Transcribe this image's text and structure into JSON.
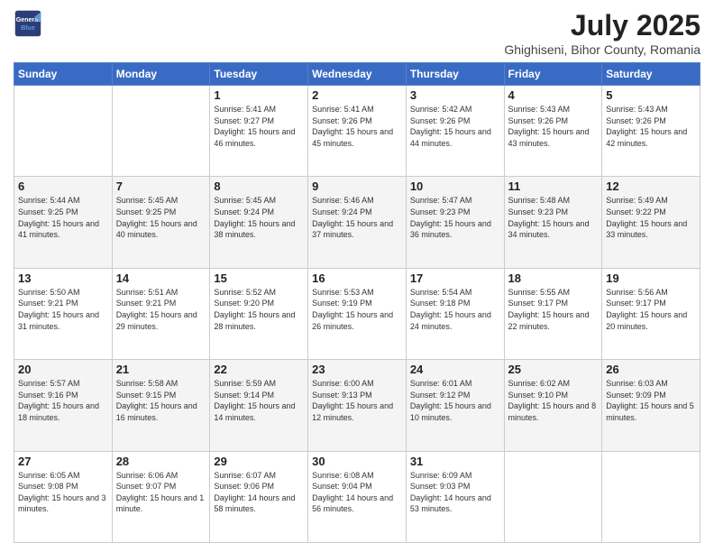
{
  "header": {
    "logo_line1": "General",
    "logo_line2": "Blue",
    "title": "July 2025",
    "subtitle": "Ghighiseni, Bihor County, Romania"
  },
  "weekdays": [
    "Sunday",
    "Monday",
    "Tuesday",
    "Wednesday",
    "Thursday",
    "Friday",
    "Saturday"
  ],
  "weeks": [
    [
      {
        "day": "",
        "info": ""
      },
      {
        "day": "",
        "info": ""
      },
      {
        "day": "1",
        "info": "Sunrise: 5:41 AM\nSunset: 9:27 PM\nDaylight: 15 hours and 46 minutes."
      },
      {
        "day": "2",
        "info": "Sunrise: 5:41 AM\nSunset: 9:26 PM\nDaylight: 15 hours and 45 minutes."
      },
      {
        "day": "3",
        "info": "Sunrise: 5:42 AM\nSunset: 9:26 PM\nDaylight: 15 hours and 44 minutes."
      },
      {
        "day": "4",
        "info": "Sunrise: 5:43 AM\nSunset: 9:26 PM\nDaylight: 15 hours and 43 minutes."
      },
      {
        "day": "5",
        "info": "Sunrise: 5:43 AM\nSunset: 9:26 PM\nDaylight: 15 hours and 42 minutes."
      }
    ],
    [
      {
        "day": "6",
        "info": "Sunrise: 5:44 AM\nSunset: 9:25 PM\nDaylight: 15 hours and 41 minutes."
      },
      {
        "day": "7",
        "info": "Sunrise: 5:45 AM\nSunset: 9:25 PM\nDaylight: 15 hours and 40 minutes."
      },
      {
        "day": "8",
        "info": "Sunrise: 5:45 AM\nSunset: 9:24 PM\nDaylight: 15 hours and 38 minutes."
      },
      {
        "day": "9",
        "info": "Sunrise: 5:46 AM\nSunset: 9:24 PM\nDaylight: 15 hours and 37 minutes."
      },
      {
        "day": "10",
        "info": "Sunrise: 5:47 AM\nSunset: 9:23 PM\nDaylight: 15 hours and 36 minutes."
      },
      {
        "day": "11",
        "info": "Sunrise: 5:48 AM\nSunset: 9:23 PM\nDaylight: 15 hours and 34 minutes."
      },
      {
        "day": "12",
        "info": "Sunrise: 5:49 AM\nSunset: 9:22 PM\nDaylight: 15 hours and 33 minutes."
      }
    ],
    [
      {
        "day": "13",
        "info": "Sunrise: 5:50 AM\nSunset: 9:21 PM\nDaylight: 15 hours and 31 minutes."
      },
      {
        "day": "14",
        "info": "Sunrise: 5:51 AM\nSunset: 9:21 PM\nDaylight: 15 hours and 29 minutes."
      },
      {
        "day": "15",
        "info": "Sunrise: 5:52 AM\nSunset: 9:20 PM\nDaylight: 15 hours and 28 minutes."
      },
      {
        "day": "16",
        "info": "Sunrise: 5:53 AM\nSunset: 9:19 PM\nDaylight: 15 hours and 26 minutes."
      },
      {
        "day": "17",
        "info": "Sunrise: 5:54 AM\nSunset: 9:18 PM\nDaylight: 15 hours and 24 minutes."
      },
      {
        "day": "18",
        "info": "Sunrise: 5:55 AM\nSunset: 9:17 PM\nDaylight: 15 hours and 22 minutes."
      },
      {
        "day": "19",
        "info": "Sunrise: 5:56 AM\nSunset: 9:17 PM\nDaylight: 15 hours and 20 minutes."
      }
    ],
    [
      {
        "day": "20",
        "info": "Sunrise: 5:57 AM\nSunset: 9:16 PM\nDaylight: 15 hours and 18 minutes."
      },
      {
        "day": "21",
        "info": "Sunrise: 5:58 AM\nSunset: 9:15 PM\nDaylight: 15 hours and 16 minutes."
      },
      {
        "day": "22",
        "info": "Sunrise: 5:59 AM\nSunset: 9:14 PM\nDaylight: 15 hours and 14 minutes."
      },
      {
        "day": "23",
        "info": "Sunrise: 6:00 AM\nSunset: 9:13 PM\nDaylight: 15 hours and 12 minutes."
      },
      {
        "day": "24",
        "info": "Sunrise: 6:01 AM\nSunset: 9:12 PM\nDaylight: 15 hours and 10 minutes."
      },
      {
        "day": "25",
        "info": "Sunrise: 6:02 AM\nSunset: 9:10 PM\nDaylight: 15 hours and 8 minutes."
      },
      {
        "day": "26",
        "info": "Sunrise: 6:03 AM\nSunset: 9:09 PM\nDaylight: 15 hours and 5 minutes."
      }
    ],
    [
      {
        "day": "27",
        "info": "Sunrise: 6:05 AM\nSunset: 9:08 PM\nDaylight: 15 hours and 3 minutes."
      },
      {
        "day": "28",
        "info": "Sunrise: 6:06 AM\nSunset: 9:07 PM\nDaylight: 15 hours and 1 minute."
      },
      {
        "day": "29",
        "info": "Sunrise: 6:07 AM\nSunset: 9:06 PM\nDaylight: 14 hours and 58 minutes."
      },
      {
        "day": "30",
        "info": "Sunrise: 6:08 AM\nSunset: 9:04 PM\nDaylight: 14 hours and 56 minutes."
      },
      {
        "day": "31",
        "info": "Sunrise: 6:09 AM\nSunset: 9:03 PM\nDaylight: 14 hours and 53 minutes."
      },
      {
        "day": "",
        "info": ""
      },
      {
        "day": "",
        "info": ""
      }
    ]
  ]
}
